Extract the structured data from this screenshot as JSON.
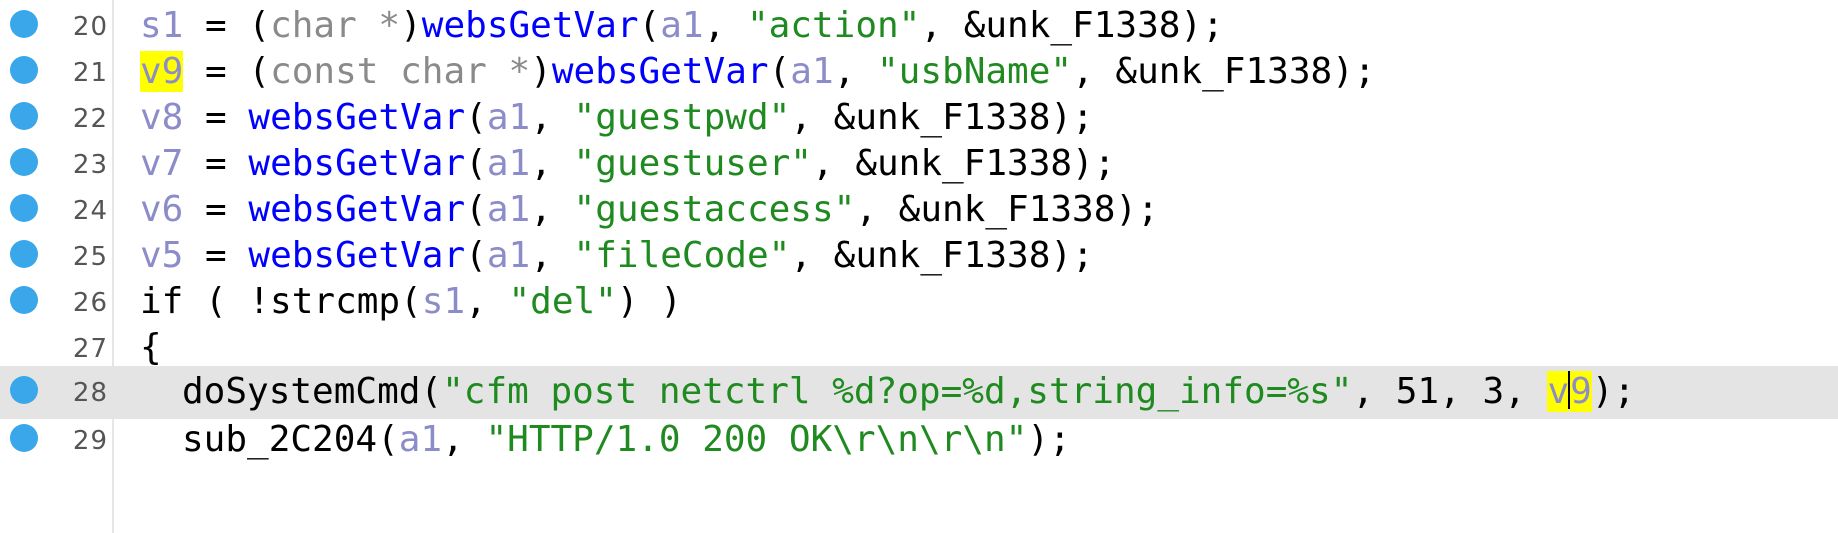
{
  "editor": {
    "lines": [
      {
        "number": "20",
        "breakpoint": true,
        "tokens": [
          {
            "t": "s1",
            "c": "var"
          },
          {
            "t": " = (",
            "c": ""
          },
          {
            "t": "char *",
            "c": "type"
          },
          {
            "t": ")",
            "c": ""
          },
          {
            "t": "websGetVar",
            "c": "fn"
          },
          {
            "t": "(",
            "c": ""
          },
          {
            "t": "a1",
            "c": "var"
          },
          {
            "t": ", ",
            "c": ""
          },
          {
            "t": "\"action\"",
            "c": "str"
          },
          {
            "t": ", &unk_F1338);",
            "c": ""
          }
        ]
      },
      {
        "number": "21",
        "breakpoint": true,
        "tokens": [
          {
            "t": "v9",
            "c": "var hl"
          },
          {
            "t": " = (",
            "c": ""
          },
          {
            "t": "const char *",
            "c": "type"
          },
          {
            "t": ")",
            "c": ""
          },
          {
            "t": "websGetVar",
            "c": "fn"
          },
          {
            "t": "(",
            "c": ""
          },
          {
            "t": "a1",
            "c": "var"
          },
          {
            "t": ", ",
            "c": ""
          },
          {
            "t": "\"usbName\"",
            "c": "str"
          },
          {
            "t": ", &unk_F1338);",
            "c": ""
          }
        ]
      },
      {
        "number": "22",
        "breakpoint": true,
        "tokens": [
          {
            "t": "v8",
            "c": "var"
          },
          {
            "t": " = ",
            "c": ""
          },
          {
            "t": "websGetVar",
            "c": "fn"
          },
          {
            "t": "(",
            "c": ""
          },
          {
            "t": "a1",
            "c": "var"
          },
          {
            "t": ", ",
            "c": ""
          },
          {
            "t": "\"guestpwd\"",
            "c": "str"
          },
          {
            "t": ", &unk_F1338);",
            "c": ""
          }
        ]
      },
      {
        "number": "23",
        "breakpoint": true,
        "tokens": [
          {
            "t": "v7",
            "c": "var"
          },
          {
            "t": " = ",
            "c": ""
          },
          {
            "t": "websGetVar",
            "c": "fn"
          },
          {
            "t": "(",
            "c": ""
          },
          {
            "t": "a1",
            "c": "var"
          },
          {
            "t": ", ",
            "c": ""
          },
          {
            "t": "\"guestuser\"",
            "c": "str"
          },
          {
            "t": ", &unk_F1338);",
            "c": ""
          }
        ]
      },
      {
        "number": "24",
        "breakpoint": true,
        "tokens": [
          {
            "t": "v6",
            "c": "var"
          },
          {
            "t": " = ",
            "c": ""
          },
          {
            "t": "websGetVar",
            "c": "fn"
          },
          {
            "t": "(",
            "c": ""
          },
          {
            "t": "a1",
            "c": "var"
          },
          {
            "t": ", ",
            "c": ""
          },
          {
            "t": "\"guestaccess\"",
            "c": "str"
          },
          {
            "t": ", &unk_F1338);",
            "c": ""
          }
        ]
      },
      {
        "number": "25",
        "breakpoint": true,
        "tokens": [
          {
            "t": "v5",
            "c": "var"
          },
          {
            "t": " = ",
            "c": ""
          },
          {
            "t": "websGetVar",
            "c": "fn"
          },
          {
            "t": "(",
            "c": ""
          },
          {
            "t": "a1",
            "c": "var"
          },
          {
            "t": ", ",
            "c": ""
          },
          {
            "t": "\"fileCode\"",
            "c": "str"
          },
          {
            "t": ", &unk_F1338);",
            "c": ""
          }
        ]
      },
      {
        "number": "26",
        "breakpoint": true,
        "tokens": [
          {
            "t": "if ( !strcmp(",
            "c": ""
          },
          {
            "t": "s1",
            "c": "var"
          },
          {
            "t": ", ",
            "c": ""
          },
          {
            "t": "\"del\"",
            "c": "str"
          },
          {
            "t": ") )",
            "c": ""
          }
        ]
      },
      {
        "number": "27",
        "breakpoint": false,
        "tokens": [
          {
            "t": "{",
            "c": ""
          }
        ]
      },
      {
        "number": "28",
        "breakpoint": true,
        "current": true,
        "tokens": [
          {
            "t": "doSystemCmd(",
            "c": ""
          },
          {
            "t": "\"cfm post netctrl %d?op=%d,string_info=%s\"",
            "c": "str"
          },
          {
            "t": ", 51, 3, ",
            "c": ""
          },
          {
            "t": "v",
            "c": "var hl"
          },
          {
            "t": "CARET",
            "c": "caret"
          },
          {
            "t": "9",
            "c": "var hl"
          },
          {
            "t": ");",
            "c": ""
          }
        ]
      },
      {
        "number": "29",
        "breakpoint": true,
        "tokens": [
          {
            "t": "sub_2C204(",
            "c": ""
          },
          {
            "t": "a1",
            "c": "var"
          },
          {
            "t": ", ",
            "c": ""
          },
          {
            "t": "\"HTTP/1.0 200 OK\\r\\n\\r\\n\"",
            "c": "str"
          },
          {
            "t": ");",
            "c": ""
          }
        ]
      }
    ]
  }
}
